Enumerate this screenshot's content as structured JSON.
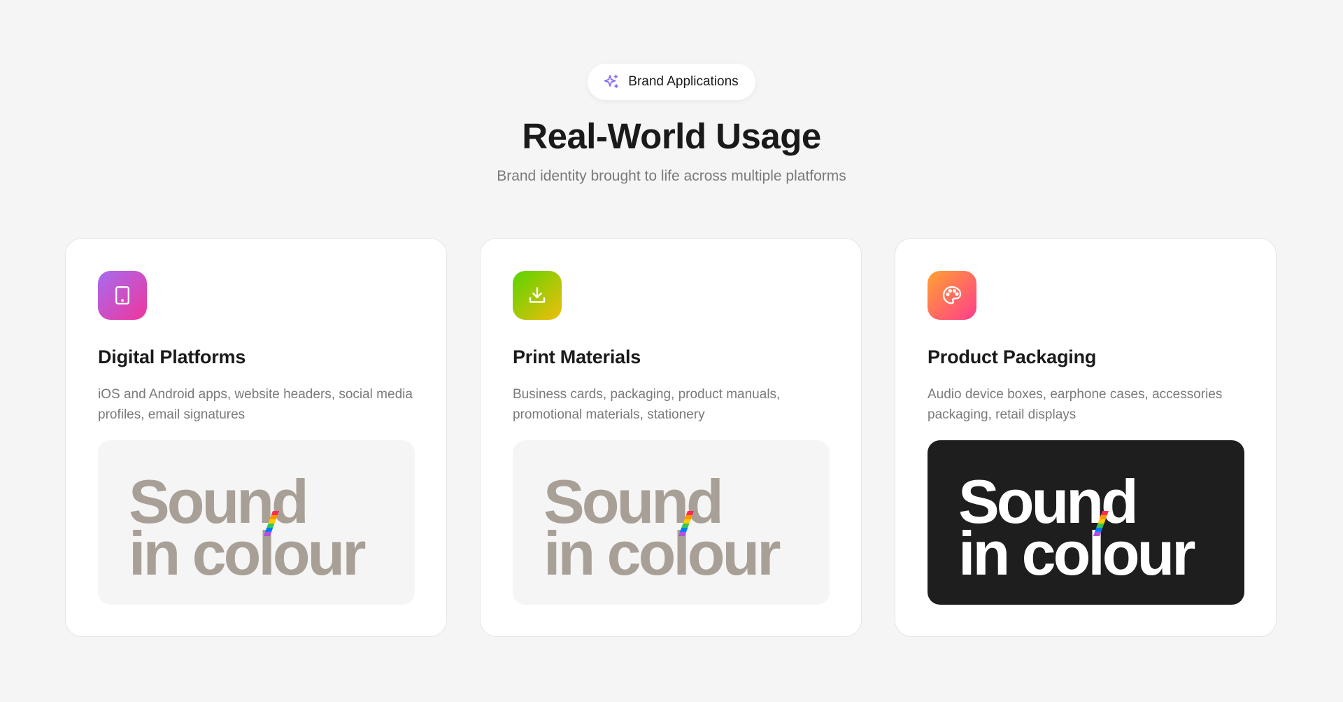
{
  "badge": {
    "label": "Brand Applications",
    "icon": "sparkle-icon",
    "icon_color": "#8b6cf0"
  },
  "header": {
    "title": "Real-World Usage",
    "subtitle": "Brand identity brought to life across multiple platforms"
  },
  "cards": [
    {
      "icon": "tablet-icon",
      "title": "Digital Platforms",
      "description": "iOS and Android apps, website headers, social media profiles, email signatures",
      "preview": {
        "theme": "light",
        "line1": "Sound",
        "line2": "in colour",
        "text_color": "#a8a097"
      }
    },
    {
      "icon": "download-icon",
      "title": "Print Materials",
      "description": "Business cards, packaging, product manuals, promotional materials, stationery",
      "preview": {
        "theme": "light",
        "line1": "Sound",
        "line2": "in colour",
        "text_color": "#a8a097"
      }
    },
    {
      "icon": "palette-icon",
      "title": "Product Packaging",
      "description": "Audio device boxes, earphone cases, accessories packaging, retail displays",
      "preview": {
        "theme": "dark",
        "line1": "Sound",
        "line2": "in colour",
        "text_color": "#ffffff"
      }
    }
  ]
}
